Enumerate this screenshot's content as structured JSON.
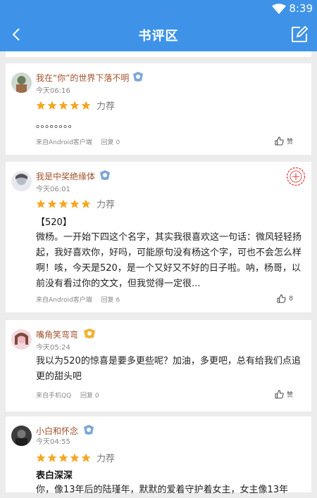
{
  "status_bar": {
    "time": "8:39"
  },
  "header": {
    "title": "书评区"
  },
  "reviews": [
    {
      "user": "我在“你”的世界下落不明",
      "time": "今天06:16",
      "rating_label": "力荐",
      "heading": "",
      "text": "。。。。。。。。",
      "source": "来自Android客户端",
      "reply": "回复 0",
      "likes": "赞"
    },
    {
      "user": "我是中奖绝缘体",
      "time": "今天06:01",
      "rating_label": "力荐",
      "heading": "【520】",
      "text": "微杨。一开始下四这个名字，其实我很喜欢这一句话：微风轻轻扬起，我好喜欢你，好吗，可能原句没有杨这个字，可也不会怎么样啊！咳，今天是520，是一个又好又不好的日子啦。呐，杨哥，以前没有看过你的文文，但我觉得一定很...",
      "source": "来自Android客户端",
      "reply": "回复 6",
      "likes": "8"
    },
    {
      "user": "嘴角笑弯弯",
      "time": "今天05:24",
      "rating_label": "",
      "heading": "",
      "text": "我以为520的惊喜是要多更些呢？加油，多更吧，总有给我们点追更的甜头吧",
      "source": "来自手机QQ",
      "reply": "回复 0",
      "likes": "赞"
    },
    {
      "user": "小白和怀念",
      "time": "今天04:55",
      "rating_label": "力荐",
      "heading": "表白深深",
      "text": "你，像13年后的陆瑾年，默默的爱着守护着女主，女主像13年",
      "source": "",
      "reply": "",
      "likes": ""
    }
  ],
  "colors": {
    "accent": "#3e93e8",
    "star": "#f5a623",
    "username": "#a0522d"
  }
}
